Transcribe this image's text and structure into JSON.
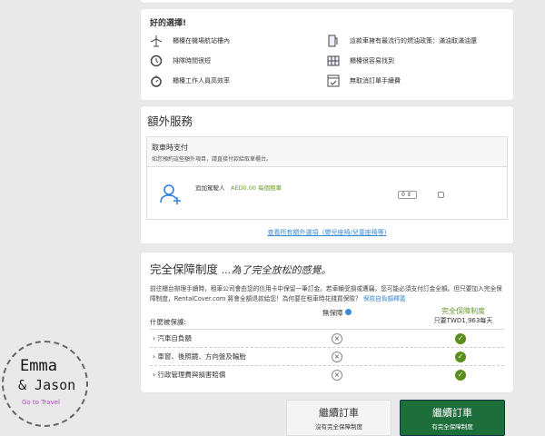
{
  "good_choice": {
    "title": "好的選擇!",
    "features": [
      {
        "icon": "airplane-icon",
        "text": "櫃檯在機場航站樓內"
      },
      {
        "icon": "fuel-pump-icon",
        "text": "這款車擁有最流行的燃油政策：滿油取滿油還"
      },
      {
        "icon": "clock-icon",
        "text": "排隊時間很短"
      },
      {
        "icon": "map-icon",
        "text": "櫃檯很容易找到"
      },
      {
        "icon": "stopwatch-icon",
        "text": "櫃檯工作人員高效率"
      },
      {
        "icon": "calendar-check-icon",
        "text": "無取消訂單手續費"
      }
    ]
  },
  "extras": {
    "title": "額外服務",
    "pay_title": "取車時支付",
    "pay_desc": "如您預約這些額外項目，請直接付款給取車櫃台。",
    "item_label": "追加駕駛人",
    "item_price": "AED0.00 每個租車",
    "qty": "0",
    "link": "查看所有額外選項（嬰兒座椅/兒童座椅等)"
  },
  "cover": {
    "title": "完全保障制度",
    "subtitle": "...為了完全放松的感覺。",
    "desc": "前往櫃台辦理手續時，租車公司會由您的信用卡中保留一筆訂金。若車輛受損或遭竊，您可能必須支付訂金全額。但只要加入完全保障制度，RentalCover.com 將會全額退款給您！為何要在租車時花錢買保險？",
    "desc_link": "保險自負額釋義",
    "what": "什麼被保護:",
    "no_cover": "無保障",
    "full_cover": "完全保障制度",
    "price": "只要TWD1,963每天",
    "rows": [
      "汽車自負額",
      "車窗、後照鏡、方向盤及輪胎",
      "行政管理費與損害賠償"
    ]
  },
  "buttons": {
    "no_main": "繼續訂車",
    "no_sub": "沒有完全保障制度",
    "yes_main": "繼續訂車",
    "yes_sub": "有完全保障制度"
  },
  "watermark": {
    "line1": "Emma",
    "line2": "& Jason",
    "line3": "Go to Travel"
  }
}
